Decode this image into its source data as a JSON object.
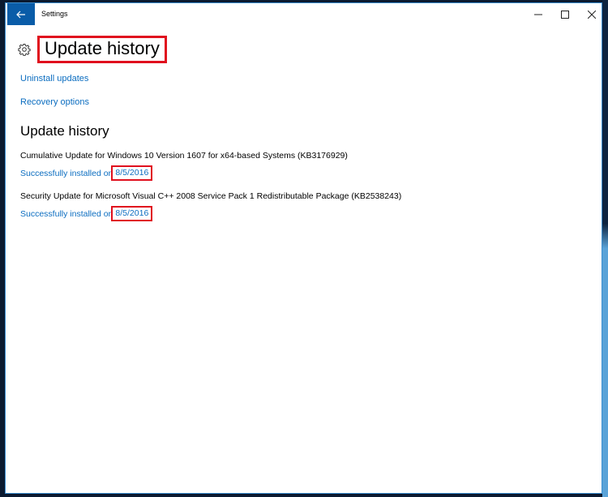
{
  "window": {
    "app_title": "Settings",
    "back_icon": "arrow-left-icon",
    "controls": {
      "minimize_icon": "minimize-icon",
      "maximize_icon": "maximize-icon",
      "close_icon": "close-icon",
      "minimize_glyph": "—",
      "maximize_glyph": "☐",
      "close_glyph": "✕"
    }
  },
  "header": {
    "icon": "gear-icon",
    "title": "Update history"
  },
  "links": {
    "uninstall": "Uninstall updates",
    "recovery": "Recovery options"
  },
  "section": {
    "title": "Update history"
  },
  "updates": [
    {
      "name": "Cumulative Update for Windows 10 Version 1607 for x64-based Systems (KB3176929)",
      "status_prefix": "Successfully installed on",
      "date": "8/5/2016"
    },
    {
      "name": "Security Update for Microsoft Visual C++ 2008 Service Pack 1 Redistributable Package (KB2538243)",
      "status_prefix": "Successfully installed on",
      "date": "8/5/2016"
    }
  ],
  "colors": {
    "accent": "#0b6dc0",
    "back_button": "#0a5ca8",
    "highlight": "#e0101e"
  }
}
